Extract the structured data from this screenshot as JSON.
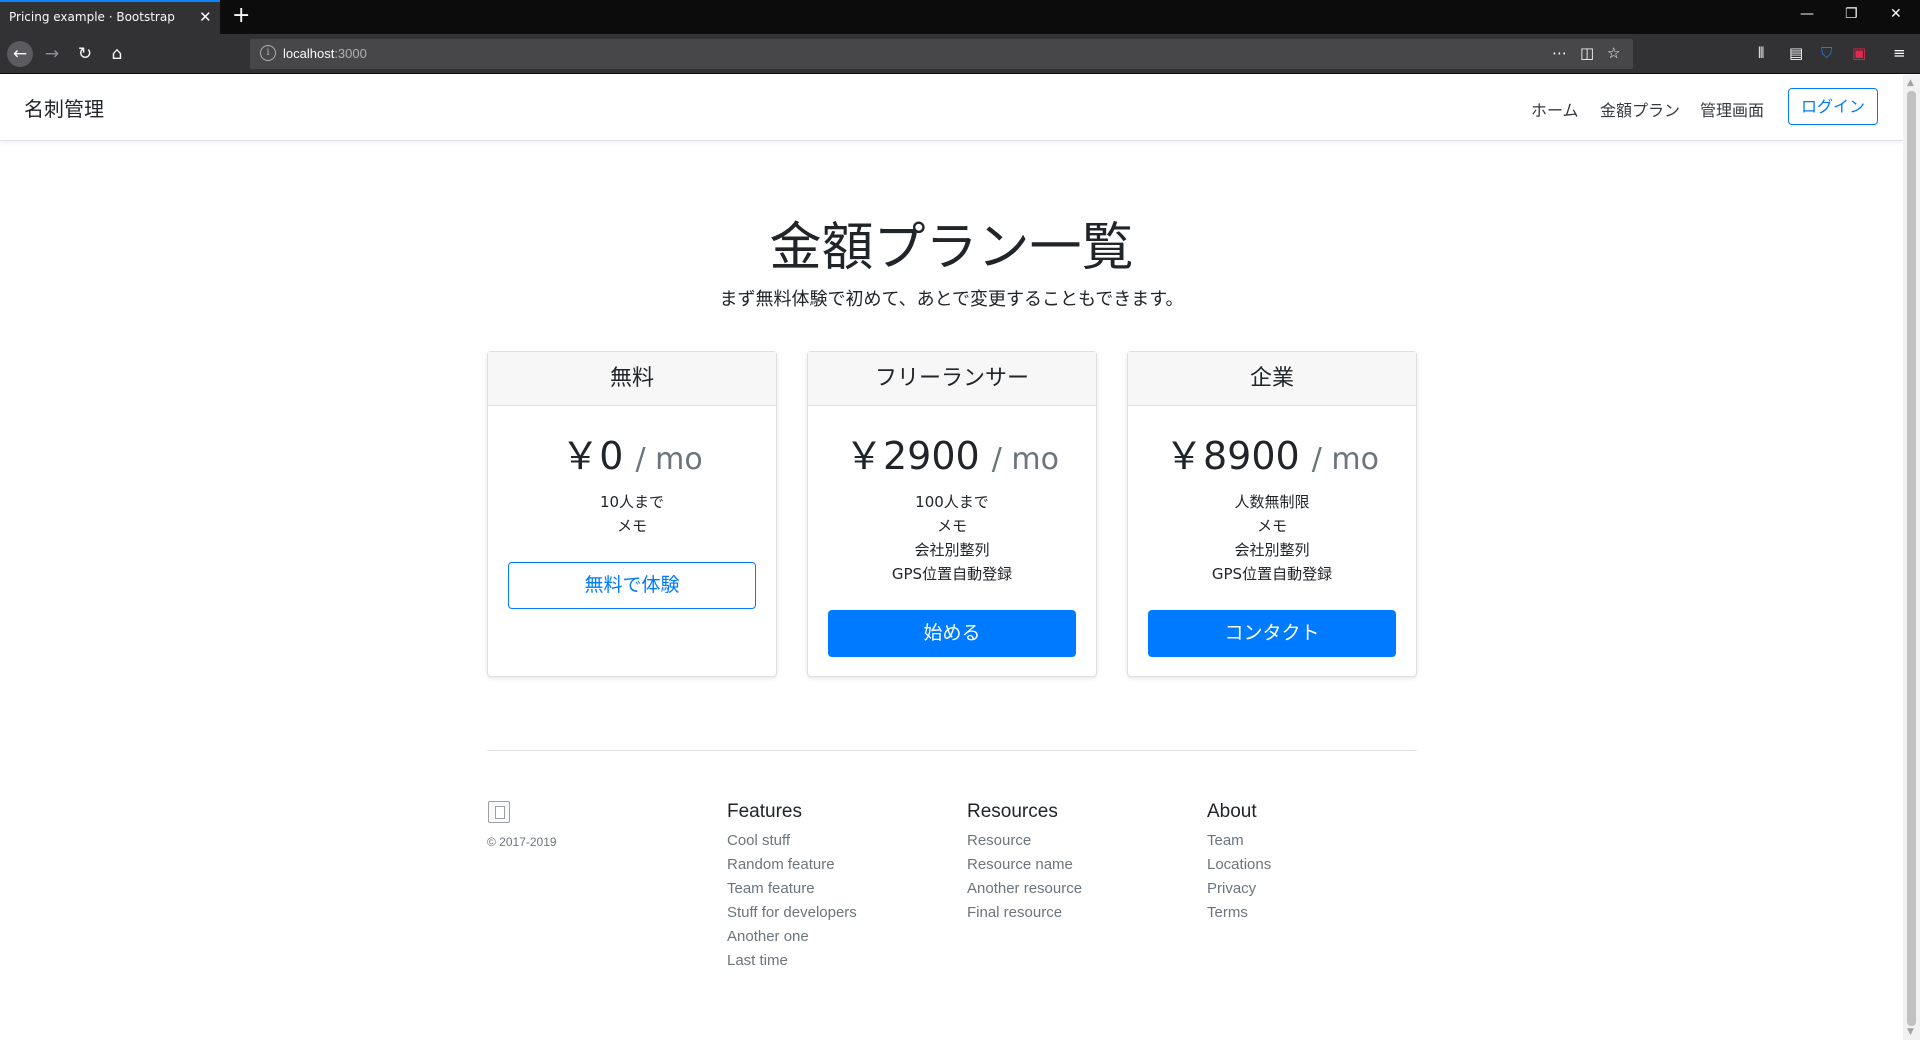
{
  "browser": {
    "tab_title": "Pricing example · Bootstrap",
    "url_host": "localhost",
    "url_port": ":3000"
  },
  "site": {
    "brand": "名刺管理",
    "nav": [
      "ホーム",
      "金額プラン",
      "管理画面"
    ],
    "login": "ログイン"
  },
  "hero": {
    "title": "金額プラン一覧",
    "lead": "まず無料体験で初めて、あとで変更することもできます。"
  },
  "plans": [
    {
      "name": "無料",
      "price": "￥0",
      "period": "/ mo",
      "features": [
        "10人まで",
        "メモ"
      ],
      "button": "無料で体験",
      "button_style": "outline"
    },
    {
      "name": "フリーランサー",
      "price": "￥2900",
      "period": "/ mo",
      "features": [
        "100人まで",
        "メモ",
        "会社別整列",
        "GPS位置自動登録"
      ],
      "button": "始める",
      "button_style": "solid"
    },
    {
      "name": "企業",
      "price": "￥8900",
      "period": "/ mo",
      "features": [
        "人数無制限",
        "メモ",
        "会社別整列",
        "GPS位置自動登録"
      ],
      "button": "コンタクト",
      "button_style": "solid"
    }
  ],
  "footer": {
    "copyright": "© 2017-2019",
    "columns": [
      {
        "title": "Features",
        "links": [
          "Cool stuff",
          "Random feature",
          "Team feature",
          "Stuff for developers",
          "Another one",
          "Last time"
        ]
      },
      {
        "title": "Resources",
        "links": [
          "Resource",
          "Resource name",
          "Another resource",
          "Final resource"
        ]
      },
      {
        "title": "About",
        "links": [
          "Team",
          "Locations",
          "Privacy",
          "Terms"
        ]
      }
    ]
  },
  "colors": {
    "primary": "#007bff",
    "chrome_dark": "#0c0c0d",
    "chrome_toolbar": "#323234",
    "muted": "#6c757d"
  }
}
